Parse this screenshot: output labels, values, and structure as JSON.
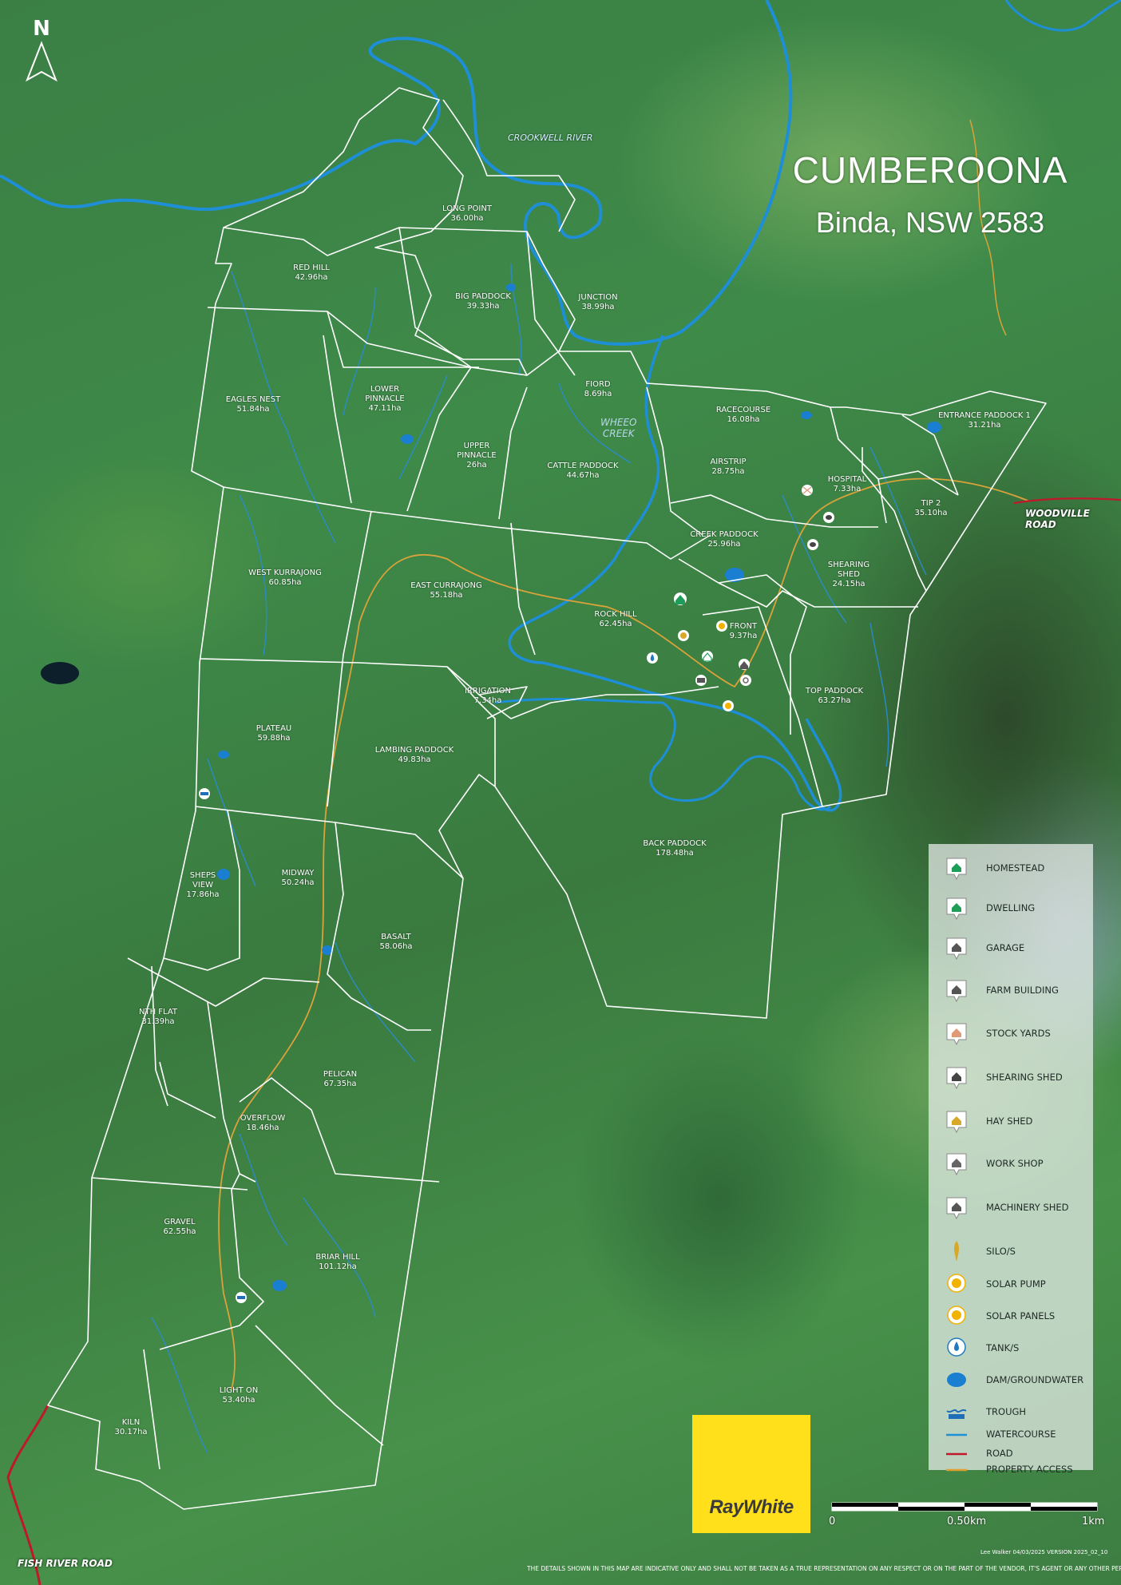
{
  "map": {
    "title": "CUMBEROONA",
    "subtitle": "Binda, NSW 2583",
    "north_label": "N",
    "water_labels": {
      "crookwell": "CROOKWELL RIVER",
      "wheeo_1": "WHEEO",
      "wheeo_2": "CREEK"
    },
    "road_labels": {
      "woodville": "WOODVILLE ROAD",
      "fish_river": "FISH RIVER ROAD"
    },
    "paddocks": [
      {
        "name": "LONG POINT",
        "area": "36.00ha"
      },
      {
        "name": "RED HILL",
        "area": "42.96ha"
      },
      {
        "name": "BIG PADDOCK",
        "area": "39.33ha"
      },
      {
        "name": "JUNCTION",
        "area": "38.99ha"
      },
      {
        "name": "EAGLES NEST",
        "area": "51.84ha"
      },
      {
        "name": "LOWER",
        "name2": "PINNACLE",
        "area": "47.11ha"
      },
      {
        "name": "FIORD",
        "area": "8.69ha"
      },
      {
        "name": "RACECOURSE",
        "area": "16.08ha"
      },
      {
        "name": "ENTRANCE PADDOCK 1",
        "area": "31.21ha"
      },
      {
        "name": "UPPER",
        "name2": "PINNACLE",
        "area": "26ha"
      },
      {
        "name": "CATTLE PADDOCK",
        "area": "44.67ha"
      },
      {
        "name": "AIRSTRIP",
        "area": "28.75ha"
      },
      {
        "name": "HOSPITAL",
        "area": "7.33ha"
      },
      {
        "name": "TIP 2",
        "area": "35.10ha"
      },
      {
        "name": "CREEK PADDOCK",
        "area": "25.96ha"
      },
      {
        "name": "SHEARING",
        "name2": "SHED",
        "area": "24.15ha"
      },
      {
        "name": "WEST KURRAJONG",
        "area": "60.85ha"
      },
      {
        "name": "EAST CURRAJONG",
        "area": "55.18ha"
      },
      {
        "name": "ROCK HILL",
        "area": "62.45ha"
      },
      {
        "name": "FRONT",
        "area": "9.37ha"
      },
      {
        "name": "TOP PADDOCK",
        "area": "63.27ha"
      },
      {
        "name": "IRRIGATION",
        "area": "7.34ha"
      },
      {
        "name": "PLATEAU",
        "area": "59.88ha"
      },
      {
        "name": "LAMBING PADDOCK",
        "area": "49.83ha"
      },
      {
        "name": "BACK PADDOCK",
        "area": "178.48ha"
      },
      {
        "name": "SHEPS",
        "name2": "VIEW",
        "area": "17.86ha"
      },
      {
        "name": "MIDWAY",
        "area": "50.24ha"
      },
      {
        "name": "BASALT",
        "area": "58.06ha"
      },
      {
        "name": "NTH FLAT",
        "area": "31.39ha"
      },
      {
        "name": "PELICAN",
        "area": "67.35ha"
      },
      {
        "name": "OVERFLOW",
        "area": "18.46ha"
      },
      {
        "name": "GRAVEL",
        "area": "62.55ha"
      },
      {
        "name": "BRIAR HILL",
        "area": "101.12ha"
      },
      {
        "name": "LIGHT ON",
        "area": "53.40ha"
      },
      {
        "name": "KILN",
        "area": "30.17ha"
      }
    ]
  },
  "legend": {
    "items": [
      {
        "label": "HOMESTEAD",
        "icon": "homestead-icon",
        "color": "#1f9e5a"
      },
      {
        "label": "DWELLING",
        "icon": "dwelling-icon",
        "color": "#1f9e5a"
      },
      {
        "label": "GARAGE",
        "icon": "garage-icon",
        "color": "#555555"
      },
      {
        "label": "FARM BUILDING",
        "icon": "farm-building-icon",
        "color": "#555555"
      },
      {
        "label": "STOCK YARDS",
        "icon": "stock-yards-icon",
        "color": "#e09a78"
      },
      {
        "label": "SHEARING SHED",
        "icon": "shearing-shed-icon",
        "color": "#444444"
      },
      {
        "label": "HAY SHED",
        "icon": "hay-shed-icon",
        "color": "#d8a928"
      },
      {
        "label": "WORK SHOP",
        "icon": "work-shop-icon",
        "color": "#666666"
      },
      {
        "label": "MACHINERY SHED",
        "icon": "machinery-shed-icon",
        "color": "#555555"
      },
      {
        "label": "SILO/S",
        "icon": "silo-icon",
        "color": "#d8a928"
      },
      {
        "label": "SOLAR PUMP",
        "icon": "solar-pump-icon",
        "color": "#f2b200"
      },
      {
        "label": "SOLAR PANELS",
        "icon": "solar-panels-icon",
        "color": "#f2b200"
      },
      {
        "label": "TANK/S",
        "icon": "tank-icon",
        "color": "#1f7ac0"
      },
      {
        "label": "DAM/GROUNDWATER",
        "icon": "dam-icon",
        "color": "#1a7fd1"
      },
      {
        "label": "TROUGH",
        "icon": "trough-icon",
        "color": "#1f6fb8"
      },
      {
        "label": "WATERCOURSE",
        "icon": "watercourse-line",
        "color": "#1e90d8"
      },
      {
        "label": "ROAD",
        "icon": "road-line",
        "color": "#c0182a"
      },
      {
        "label": "PROPERTY ACCESS",
        "icon": "property-access-line",
        "color": "#e0a030"
      }
    ]
  },
  "scale_bar": {
    "zero": "0",
    "mid": "0.50km",
    "max": "1km"
  },
  "branding": {
    "agency": "RayWhite",
    "brand_color": "#ffe01b"
  },
  "footer": {
    "credit": "Lee Walker 04/03/2025 VERSION 2025_02_10",
    "disclaimer": "THE DETAILS SHOWN IN THIS MAP ARE INDICATIVE ONLY AND SHALL NOT BE TAKEN AS A TRUE REPRESENTATION ON ANY RESPECT OR ON THE PART OF THE VENDOR, IT'S AGENT OR ANY OTHER PERSON."
  }
}
